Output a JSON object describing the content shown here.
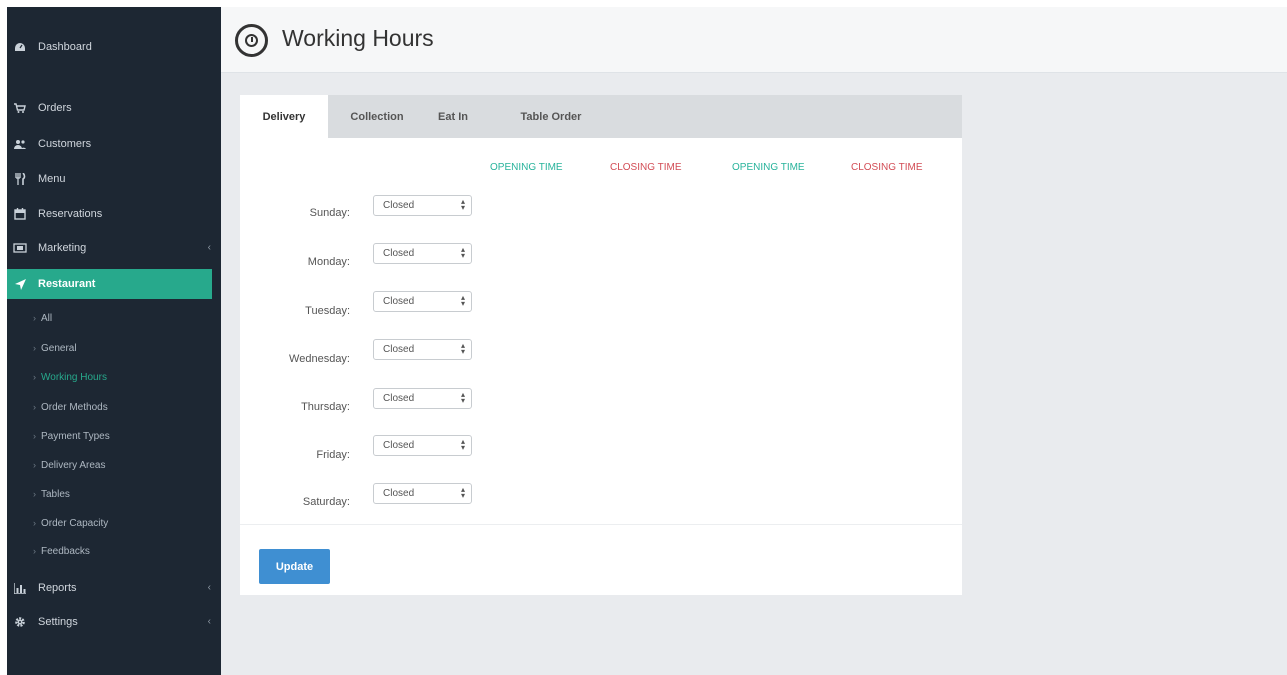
{
  "header": {
    "title": "Working Hours"
  },
  "sidebar": {
    "items": [
      {
        "label": "Dashboard",
        "icon": "dashboard-icon"
      },
      {
        "label": "Orders",
        "icon": "cart-icon"
      },
      {
        "label": "Customers",
        "icon": "users-icon"
      },
      {
        "label": "Menu",
        "icon": "cutlery-icon"
      },
      {
        "label": "Reservations",
        "icon": "calendar-icon"
      },
      {
        "label": "Marketing",
        "icon": "marketing-icon"
      },
      {
        "label": "Restaurant",
        "icon": "location-arrow-icon"
      },
      {
        "label": "Reports",
        "icon": "bar-chart-icon"
      },
      {
        "label": "Settings",
        "icon": "gear-icon"
      }
    ],
    "subitems": [
      {
        "label": "All"
      },
      {
        "label": "General"
      },
      {
        "label": "Working Hours"
      },
      {
        "label": "Order Methods"
      },
      {
        "label": "Payment Types"
      },
      {
        "label": "Delivery Areas"
      },
      {
        "label": "Tables"
      },
      {
        "label": "Order Capacity"
      },
      {
        "label": "Feedbacks"
      }
    ]
  },
  "tabs": [
    {
      "label": "Delivery"
    },
    {
      "label": "Collection"
    },
    {
      "label": "Eat In"
    },
    {
      "label": "Table Order"
    }
  ],
  "columns": [
    {
      "label": "OPENING TIME"
    },
    {
      "label": "CLOSING TIME"
    },
    {
      "label": "OPENING TIME"
    },
    {
      "label": "CLOSING TIME"
    }
  ],
  "days": [
    {
      "label": "Sunday:",
      "value": "Closed"
    },
    {
      "label": "Monday:",
      "value": "Closed"
    },
    {
      "label": "Tuesday:",
      "value": "Closed"
    },
    {
      "label": "Wednesday:",
      "value": "Closed"
    },
    {
      "label": "Thursday:",
      "value": "Closed"
    },
    {
      "label": "Friday:",
      "value": "Closed"
    },
    {
      "label": "Saturday:",
      "value": "Closed"
    }
  ],
  "actions": {
    "update_label": "Update"
  },
  "colors": {
    "sidebar_bg": "#1d2733",
    "accent": "#27a98c",
    "opening": "#27b39b",
    "closing": "#d24c55",
    "button": "#3f8fd2"
  }
}
